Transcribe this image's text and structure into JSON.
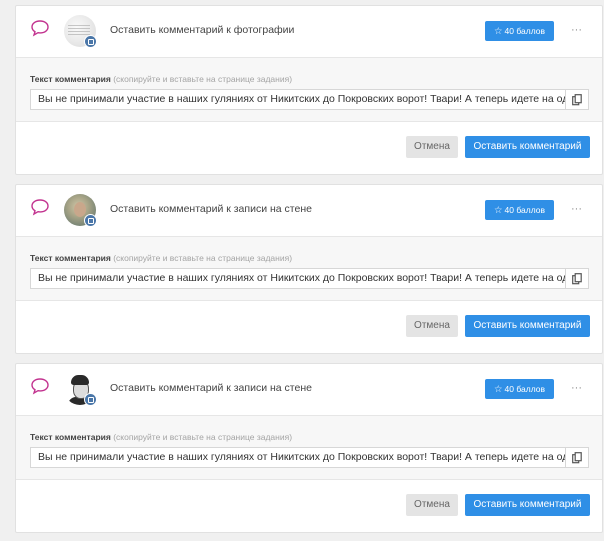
{
  "tasks": [
    {
      "title": "Оставить комментарий к фотографии",
      "points_label": "40 баллов",
      "comment_label": "Текст комментария",
      "comment_hint": "(скопируйте и вставьте на странице задания)",
      "comment_text": "Вы не принимали участие в наших гуляниях от Никитских до Покровских ворот! Твари! А теперь идете на одобр",
      "cancel_label": "Отмена",
      "submit_label": "Оставить комментарий",
      "more_label": "···"
    },
    {
      "title": "Оставить комментарий к записи на стене",
      "points_label": "40 баллов",
      "comment_label": "Текст комментария",
      "comment_hint": "(скопируйте и вставьте на странице задания)",
      "comment_text": "Вы не принимали участие в наших гуляниях от Никитских до Покровских ворот! Твари! А теперь идете на одобр",
      "cancel_label": "Отмена",
      "submit_label": "Оставить комментарий",
      "more_label": "···"
    },
    {
      "title": "Оставить комментарий к записи на стене",
      "points_label": "40 баллов",
      "comment_label": "Текст комментария",
      "comment_hint": "(скопируйте и вставьте на странице задания)",
      "comment_text": "Вы не принимали участие в наших гуляниях от Никитских до Покровских ворот! Твари! А теперь идете на одобр",
      "cancel_label": "Отмена",
      "submit_label": "Оставить комментарий",
      "more_label": "···"
    }
  ],
  "colors": {
    "accent": "#2f8fe6",
    "chat_icon": "#c2338f",
    "vk_badge": "#4a76a8"
  },
  "icons": {
    "task_type": "comment-bubble-icon",
    "points": "star-icon",
    "copy": "copy-icon",
    "more": "more-dots-icon"
  }
}
